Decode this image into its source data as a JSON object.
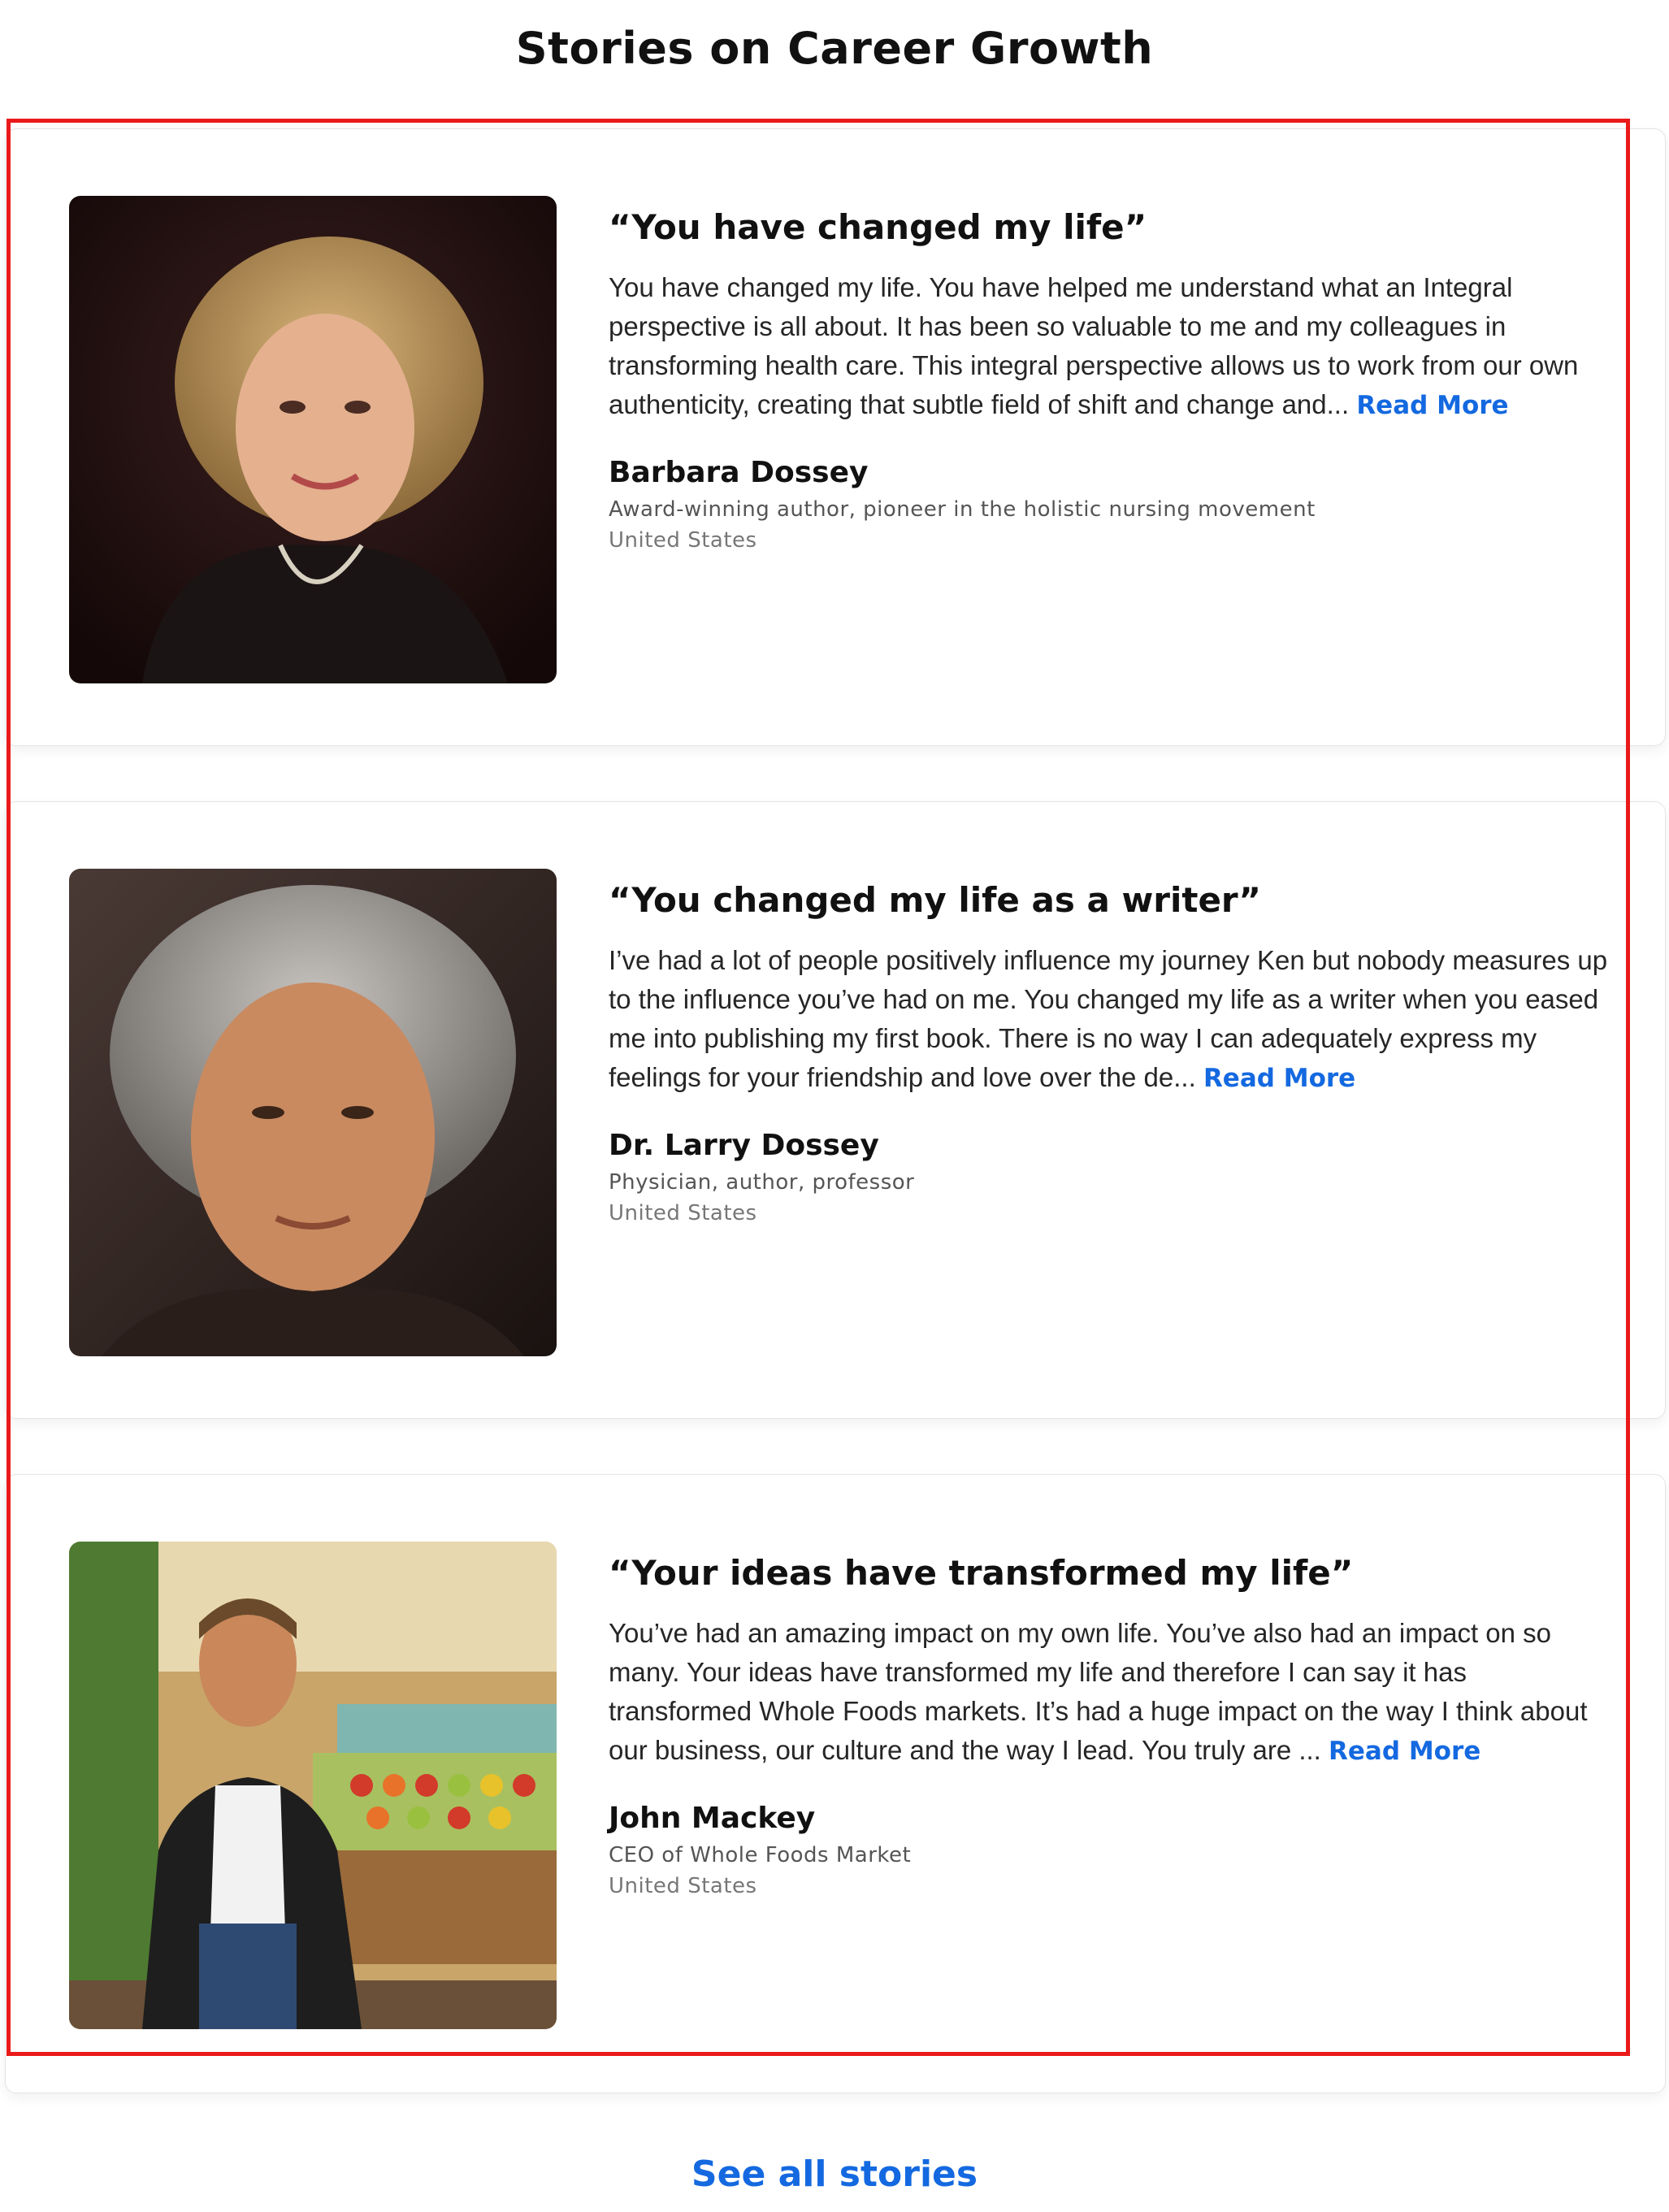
{
  "page": {
    "title": "Stories on Career Growth",
    "see_all_label": "See all stories"
  },
  "colors": {
    "accent_link": "#1469e0",
    "highlight_border": "#ea1a1a",
    "card_border": "#e4e4e8"
  },
  "stories": [
    {
      "title": "“You have changed my life”",
      "body": "You have changed my life. You have helped me understand what an Integral perspective is all about. It has been so valuable to me and my colleagues in transforming health care. This integral perspective allows us to work from our own authenticity, creating that subtle field of shift and change and... ",
      "read_more": "Read More",
      "author": "Barbara Dossey",
      "role": "Award-winning author, pioneer in the holistic nursing movement",
      "country": "United States"
    },
    {
      "title": "“You changed my life as a writer”",
      "body": "I’ve had a lot of people positively influence my journey Ken but nobody measures up to the influence you’ve had on me. You changed my life as a writer when you eased me into publishing my first book. There is no way I can adequately express my feelings for your friendship and love over the de... ",
      "read_more": "Read More",
      "author": "Dr. Larry Dossey",
      "role": "Physician, author, professor",
      "country": "United States"
    },
    {
      "title": "“Your ideas have transformed my life”",
      "body": "You’ve had an amazing impact on my own life. You’ve also had an impact on so many. Your ideas have transformed my life and therefore I can say it has transformed Whole Foods markets. It’s had a huge impact on the way I think about our business, our culture and the way I lead. You truly are ... ",
      "read_more": "Read More",
      "author": "John Mackey",
      "role": "CEO of Whole Foods Market",
      "country": "United States"
    }
  ]
}
